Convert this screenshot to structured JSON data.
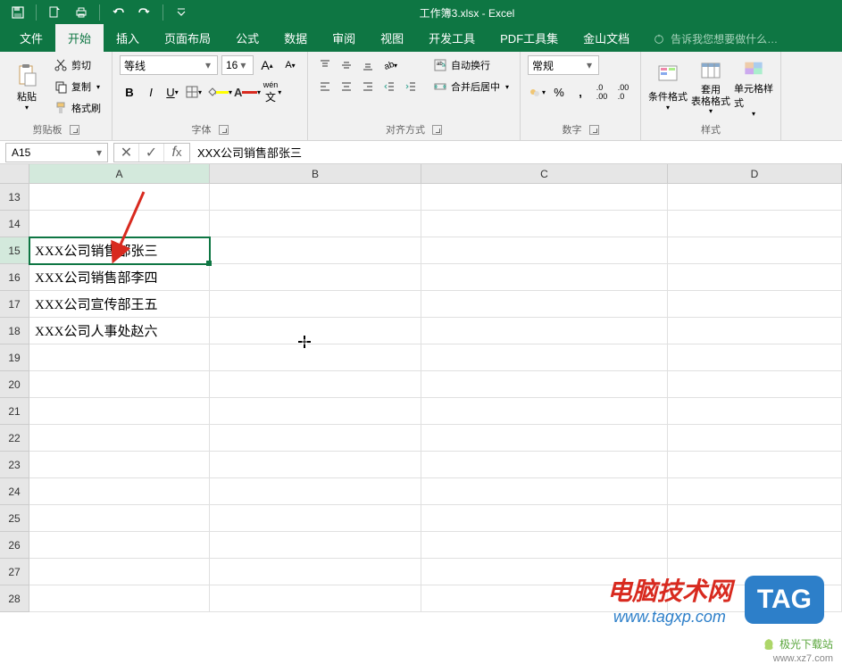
{
  "app": {
    "title": "工作簿3.xlsx - Excel"
  },
  "menu": {
    "file": "文件",
    "home": "开始",
    "insert": "插入",
    "layout": "页面布局",
    "formula": "公式",
    "data": "数据",
    "review": "审阅",
    "view": "视图",
    "dev": "开发工具",
    "pdf": "PDF工具集",
    "jinshan": "金山文档",
    "tellme": "告诉我您想要做什么…"
  },
  "clipboard": {
    "paste": "粘贴",
    "cut": "剪切",
    "copy": "复制",
    "painter": "格式刷",
    "label": "剪贴板"
  },
  "font": {
    "name": "等线",
    "size": "16",
    "label": "字体"
  },
  "align": {
    "wrap": "自动换行",
    "merge": "合并后居中",
    "label": "对齐方式"
  },
  "number": {
    "format": "常规",
    "label": "数字"
  },
  "styles": {
    "cond": "条件格式",
    "table": "套用\n表格格式",
    "cell": "单元格样式",
    "label": "样式"
  },
  "formula_bar": {
    "ref": "A15",
    "value": "XXX公司销售部张三"
  },
  "columns": [
    "A",
    "B",
    "C",
    "D"
  ],
  "rows": [
    {
      "n": "13",
      "cells": [
        "",
        "",
        "",
        ""
      ]
    },
    {
      "n": "14",
      "cells": [
        "",
        "",
        "",
        ""
      ]
    },
    {
      "n": "15",
      "cells": [
        "XXX公司销售部张三",
        "",
        "",
        ""
      ],
      "selected": 0
    },
    {
      "n": "16",
      "cells": [
        "XXX公司销售部李四",
        "",
        "",
        ""
      ]
    },
    {
      "n": "17",
      "cells": [
        "XXX公司宣传部王五",
        "",
        "",
        ""
      ]
    },
    {
      "n": "18",
      "cells": [
        "XXX公司人事处赵六",
        "",
        "",
        ""
      ]
    },
    {
      "n": "19",
      "cells": [
        "",
        "",
        "",
        ""
      ]
    },
    {
      "n": "20",
      "cells": [
        "",
        "",
        "",
        ""
      ]
    },
    {
      "n": "21",
      "cells": [
        "",
        "",
        "",
        ""
      ]
    },
    {
      "n": "22",
      "cells": [
        "",
        "",
        "",
        ""
      ]
    },
    {
      "n": "23",
      "cells": [
        "",
        "",
        "",
        ""
      ]
    },
    {
      "n": "24",
      "cells": [
        "",
        "",
        "",
        ""
      ]
    },
    {
      "n": "25",
      "cells": [
        "",
        "",
        "",
        ""
      ]
    },
    {
      "n": "26",
      "cells": [
        "",
        "",
        "",
        ""
      ]
    },
    {
      "n": "27",
      "cells": [
        "",
        "",
        "",
        ""
      ]
    },
    {
      "n": "28",
      "cells": [
        "",
        "",
        "",
        ""
      ]
    }
  ],
  "watermark": {
    "cn": "电脑技术网",
    "url": "www.tagxp.com",
    "tag": "TAG",
    "dl": "极光下载站",
    "dl_url": "www.xz7.com"
  }
}
